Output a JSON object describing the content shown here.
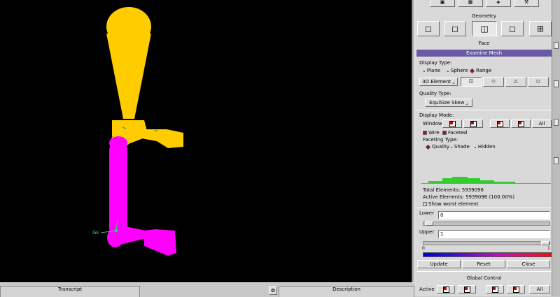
{
  "viewport": {
    "axis_label": "Gk",
    "colors": {
      "upper_part": "#ffcc00",
      "lower_part": "#ff00ff",
      "background": "#000000",
      "axis": "#32c878"
    }
  },
  "bottom": {
    "transcript": "Transcript",
    "description": "Description"
  },
  "panel": {
    "geometry": "Geometry",
    "face": "Face",
    "examine_mesh": "Examine Mesh",
    "display_type": {
      "label": "Display Type:",
      "options": [
        "Plane",
        "Sphere",
        "Range"
      ],
      "selected": "Range",
      "element_select": "3D Element"
    },
    "quality_type": {
      "label": "Quality Type:",
      "value": "EquiSize Skew"
    },
    "display_mode": {
      "label": "Display Mode:",
      "windows_label": "Windows",
      "all": "All",
      "wire": "Wire",
      "faceted": "Faceted",
      "faceting_label": "Faceting Type:",
      "faceting_options": [
        "Quality",
        "Shade",
        "Hidden"
      ],
      "faceting_selected": "Quality"
    },
    "stats": {
      "total": "Total Elements:   5939096",
      "active": "Active Elements: 5939096 (100.00%)",
      "show_worst": "Show worst element"
    },
    "lower": {
      "label": "Lower",
      "value": "0"
    },
    "upper": {
      "label": "Upper",
      "value": "1"
    },
    "scale": {
      "min_label": "0",
      "max_label": "1"
    },
    "actions": {
      "update": "Update",
      "reset": "Reset",
      "close": "Close"
    },
    "global": {
      "label": "Global Control",
      "active": "Active",
      "all": "All"
    },
    "colors": {
      "title_bar": "#6a5aa6",
      "histogram": "#33cc33"
    }
  }
}
